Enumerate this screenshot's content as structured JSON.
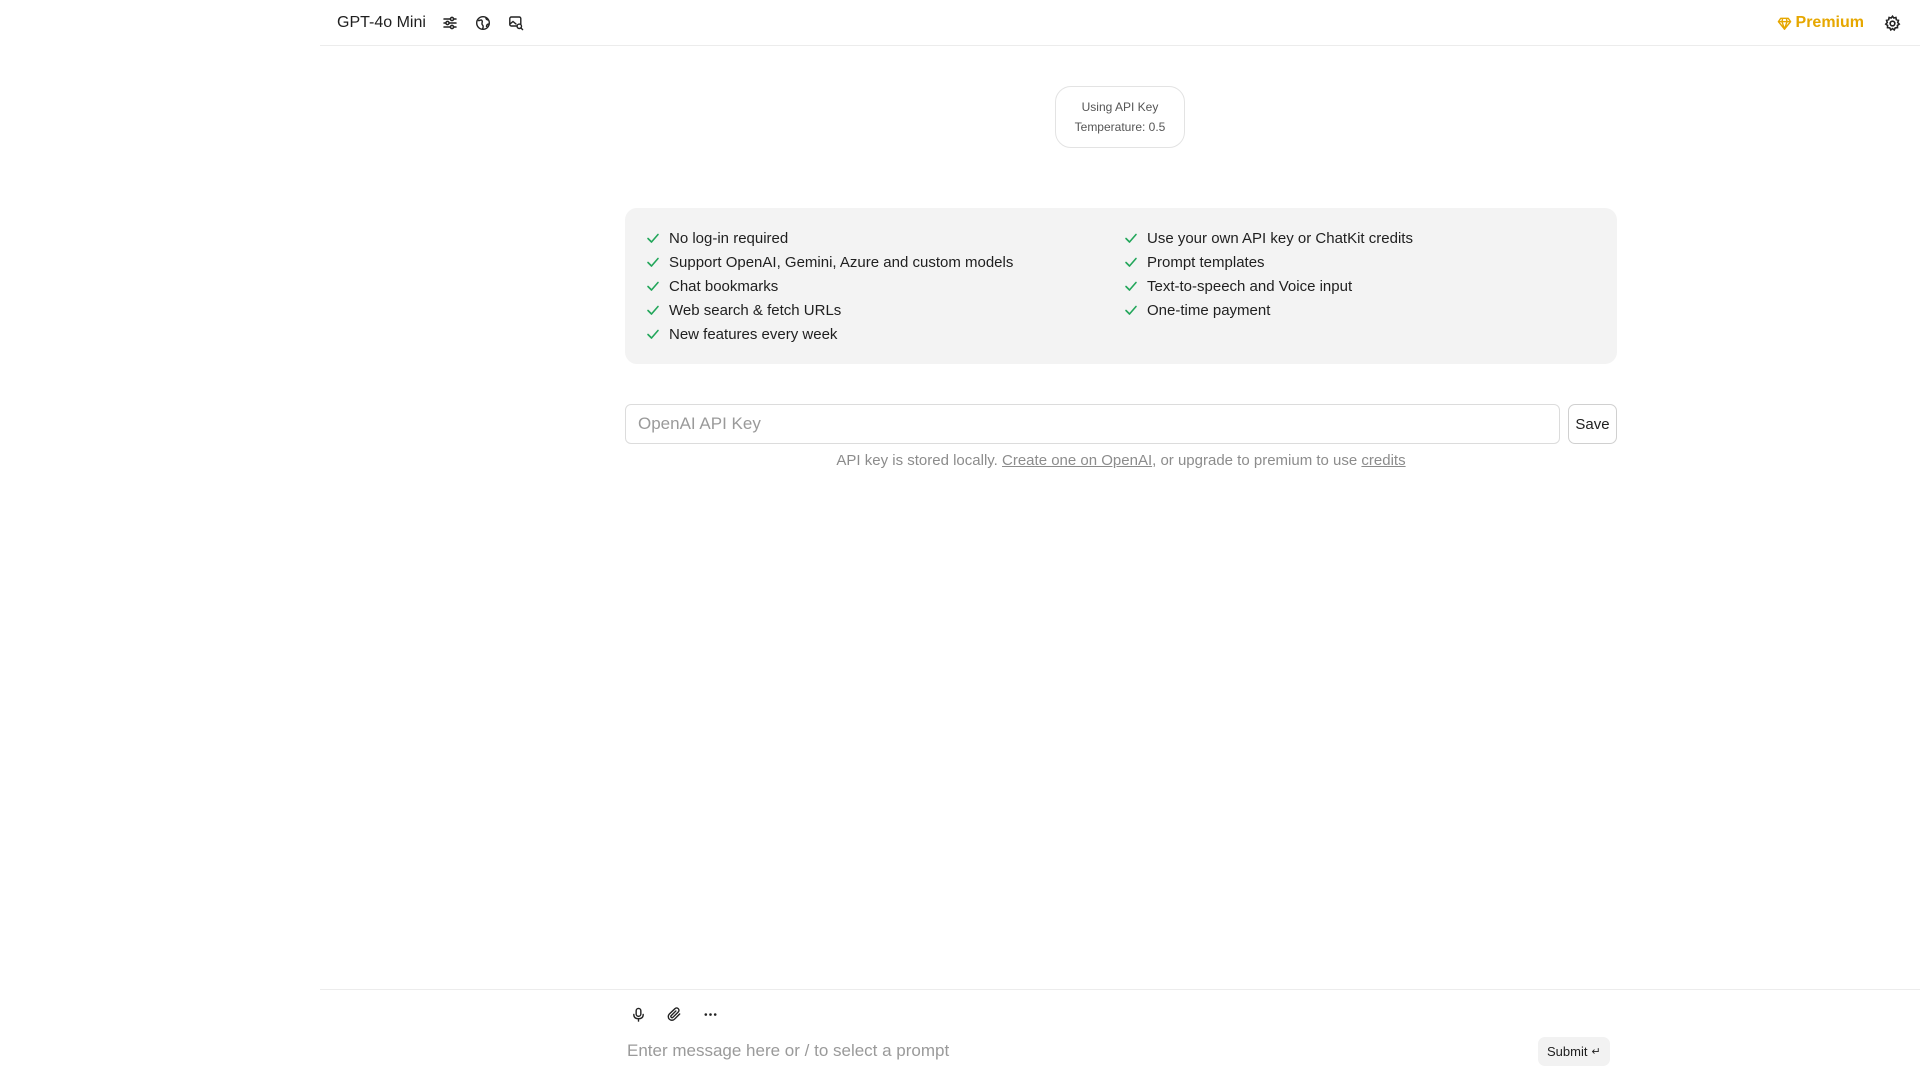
{
  "header": {
    "model_name": "GPT-4o Mini",
    "icons": [
      "sliders-icon",
      "globe-icon",
      "image-search-icon"
    ],
    "premium_label": "Premium",
    "premium_color": "#e6a700"
  },
  "info_badge": {
    "line1": "Using API Key",
    "line2": "Temperature: 0.5"
  },
  "features": {
    "check_color": "#22a65a",
    "left": [
      "No log-in required",
      "Support OpenAI, Gemini, Azure and custom models",
      "Chat bookmarks",
      "Web search & fetch URLs",
      "New features every week"
    ],
    "right": [
      "Use your own API key or ChatKit credits",
      "Prompt templates",
      "Text-to-speech and Voice input",
      "One-time payment"
    ]
  },
  "api_key": {
    "placeholder": "OpenAI API Key",
    "save_label": "Save",
    "note_prefix": "API key is stored locally. ",
    "note_link1": "Create one on OpenAI",
    "note_middle": ", or upgrade to premium to use ",
    "note_link2": "credits"
  },
  "composer": {
    "placeholder": "Enter message here or / to select a prompt",
    "submit_label": "Submit",
    "submit_key_hint": "↵"
  }
}
